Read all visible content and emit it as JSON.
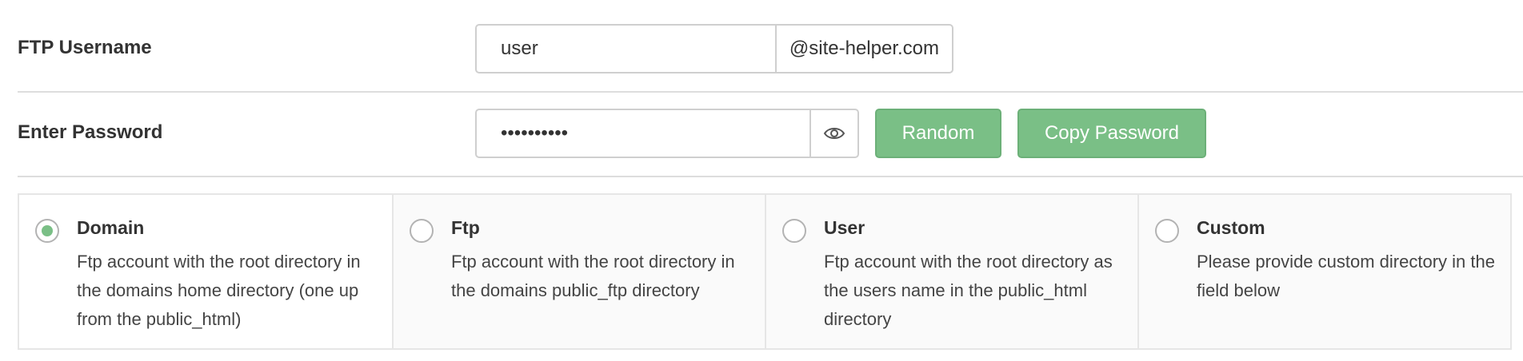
{
  "ftp_username": {
    "label": "FTP Username",
    "value": "user",
    "domain_suffix": "@site-helper.com"
  },
  "password": {
    "label": "Enter Password",
    "masked_value": "••••••••••",
    "toggle_icon": "eye-icon",
    "random_label": "Random",
    "copy_label": "Copy Password"
  },
  "colors": {
    "accent_green": "#7abf86",
    "border": "#cfcfcf"
  },
  "directory_options": [
    {
      "title": "Domain",
      "description": "Ftp account with the root directory in the domains home directory (one up from the public_html)",
      "checked": true
    },
    {
      "title": "Ftp",
      "description": "Ftp account with the root directory in the domains public_ftp directory",
      "checked": false
    },
    {
      "title": "User",
      "description": "Ftp account with the root directory as the users name in the public_html directory",
      "checked": false
    },
    {
      "title": "Custom",
      "description": "Please provide custom directory in the field below",
      "checked": false
    }
  ]
}
